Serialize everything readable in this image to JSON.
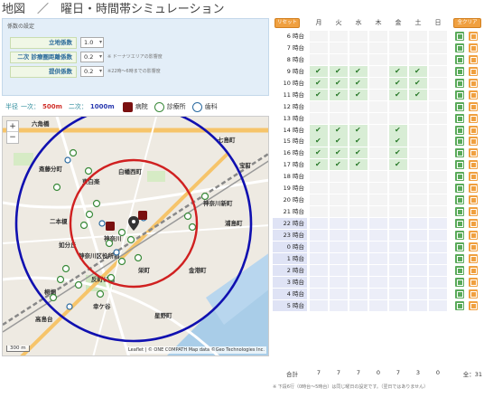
{
  "title": "地図　／　曜日・時間帯シミュレーション",
  "settings": {
    "header": "係数の設定",
    "factors": [
      {
        "label": "立地係数",
        "value": "1.0",
        "note": ""
      },
      {
        "label": "二次 診療圏距離係数",
        "value": "0.2",
        "note": "※ ドーナツエリアの影響度"
      },
      {
        "label": "提供係数",
        "value": "0.2",
        "note": "※22時～6時までの影響度"
      }
    ]
  },
  "legend": {
    "radius_label": "半径",
    "primary_label": "一次：",
    "primary_value": "500m",
    "secondary_label": "二次：",
    "secondary_value": "1000m",
    "hospital_label": "病院",
    "clinic_label": "診療所",
    "dental_label": "歯科"
  },
  "map": {
    "zoom_in": "+",
    "zoom_out": "−",
    "scale": "300 m",
    "attribution": "Leaflet | © ONE COMPATH Map data ©Geo Technologies Inc.",
    "labels": [
      "七島町",
      "白幡西町",
      "斎藤分町",
      "東白楽",
      "二本榎",
      "神奈川新町",
      "如分丘",
      "神奈川",
      "神奈川区役所前",
      "反町公園",
      "桐畑",
      "高島台",
      "幸ケ谷",
      "星野町",
      "金港町",
      "浦島町",
      "六角橋",
      "栄町",
      "宝町"
    ]
  },
  "schedule": {
    "reset_label": "リセット",
    "all_clear_label": "全クリア",
    "days": [
      "月",
      "火",
      "水",
      "木",
      "金",
      "土",
      "日"
    ],
    "hours": [
      {
        "label": "6 時台",
        "on": [
          false,
          false,
          false,
          false,
          false,
          false,
          false
        ],
        "night": false
      },
      {
        "label": "7 時台",
        "on": [
          false,
          false,
          false,
          false,
          false,
          false,
          false
        ],
        "night": false
      },
      {
        "label": "8 時台",
        "on": [
          false,
          false,
          false,
          false,
          false,
          false,
          false
        ],
        "night": false
      },
      {
        "label": "9 時台",
        "on": [
          true,
          true,
          true,
          false,
          true,
          true,
          false
        ],
        "night": false
      },
      {
        "label": "10 時台",
        "on": [
          true,
          true,
          true,
          false,
          true,
          true,
          false
        ],
        "night": false
      },
      {
        "label": "11 時台",
        "on": [
          true,
          true,
          true,
          false,
          true,
          true,
          false
        ],
        "night": false
      },
      {
        "label": "12 時台",
        "on": [
          false,
          false,
          false,
          false,
          false,
          false,
          false
        ],
        "night": false
      },
      {
        "label": "13 時台",
        "on": [
          false,
          false,
          false,
          false,
          false,
          false,
          false
        ],
        "night": false
      },
      {
        "label": "14 時台",
        "on": [
          true,
          true,
          true,
          false,
          true,
          false,
          false
        ],
        "night": false
      },
      {
        "label": "15 時台",
        "on": [
          true,
          true,
          true,
          false,
          true,
          false,
          false
        ],
        "night": false
      },
      {
        "label": "16 時台",
        "on": [
          true,
          true,
          true,
          false,
          true,
          false,
          false
        ],
        "night": false
      },
      {
        "label": "17 時台",
        "on": [
          true,
          true,
          true,
          false,
          true,
          false,
          false
        ],
        "night": false
      },
      {
        "label": "18 時台",
        "on": [
          false,
          false,
          false,
          false,
          false,
          false,
          false
        ],
        "night": false
      },
      {
        "label": "19 時台",
        "on": [
          false,
          false,
          false,
          false,
          false,
          false,
          false
        ],
        "night": false
      },
      {
        "label": "20 時台",
        "on": [
          false,
          false,
          false,
          false,
          false,
          false,
          false
        ],
        "night": false
      },
      {
        "label": "21 時台",
        "on": [
          false,
          false,
          false,
          false,
          false,
          false,
          false
        ],
        "night": false
      },
      {
        "label": "22 時台",
        "on": [
          false,
          false,
          false,
          false,
          false,
          false,
          false
        ],
        "night": true
      },
      {
        "label": "23 時台",
        "on": [
          false,
          false,
          false,
          false,
          false,
          false,
          false
        ],
        "night": true
      },
      {
        "label": "0 時台",
        "on": [
          false,
          false,
          false,
          false,
          false,
          false,
          false
        ],
        "night": true
      },
      {
        "label": "1 時台",
        "on": [
          false,
          false,
          false,
          false,
          false,
          false,
          false
        ],
        "night": true
      },
      {
        "label": "2 時台",
        "on": [
          false,
          false,
          false,
          false,
          false,
          false,
          false
        ],
        "night": true
      },
      {
        "label": "3 時台",
        "on": [
          false,
          false,
          false,
          false,
          false,
          false,
          false
        ],
        "night": true
      },
      {
        "label": "4 時台",
        "on": [
          false,
          false,
          false,
          false,
          false,
          false,
          false
        ],
        "night": true
      },
      {
        "label": "5 時台",
        "on": [
          false,
          false,
          false,
          false,
          false,
          false,
          false
        ],
        "night": true
      }
    ],
    "total_label": "合計",
    "totals": [
      "7",
      "7",
      "7",
      "0",
      "7",
      "3",
      "0"
    ],
    "grand_total": "全：31",
    "footnote": "※ 下段6行（0時台～5時台）は同じ曜日の設定です。（翌日ではありません）"
  },
  "colors": {
    "primary_circle": "#d02020",
    "secondary_circle": "#1010b0",
    "hospital": "#7a1010",
    "check_on": "#d8edd5",
    "button_orange": "#f0a040",
    "button_green": "#5aaa5a"
  }
}
